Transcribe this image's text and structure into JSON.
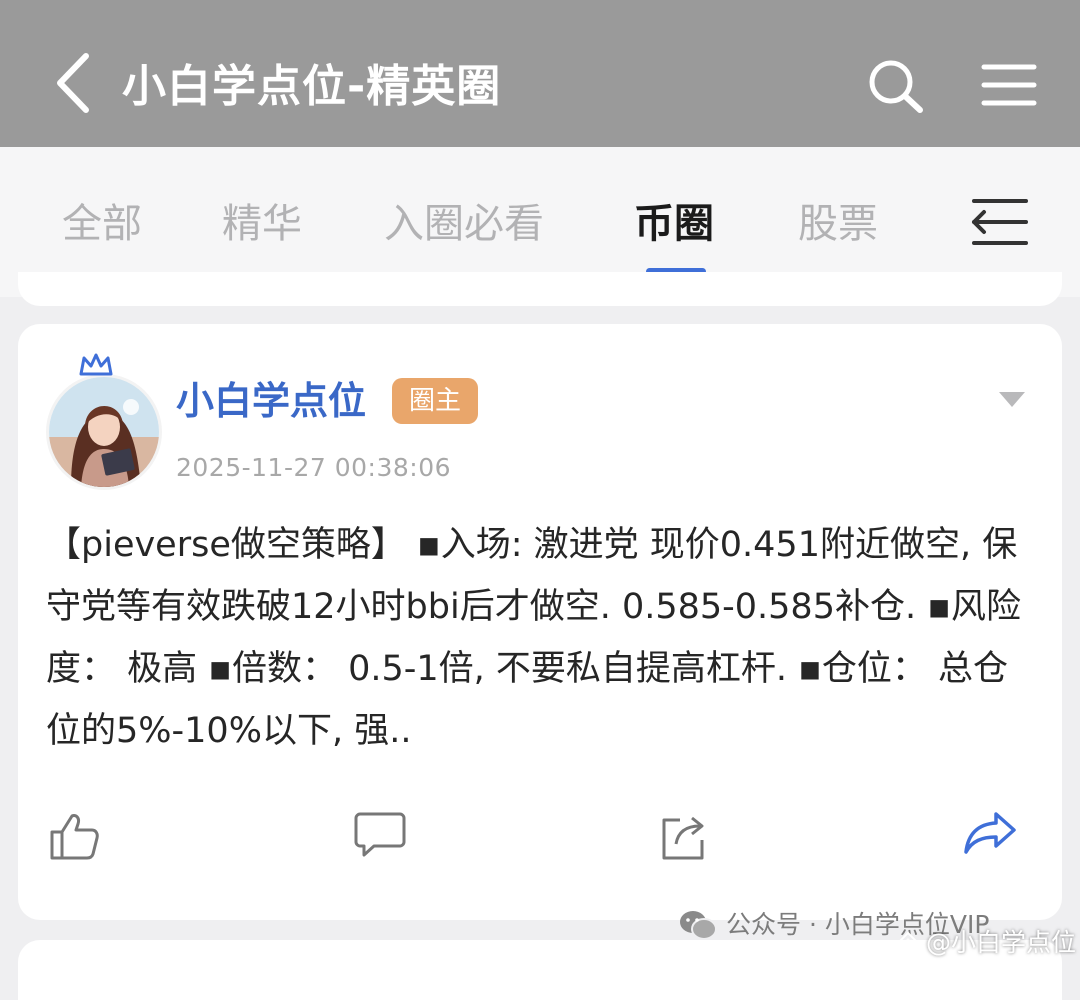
{
  "header": {
    "title": "小白学点位-精英圈",
    "icons": [
      "chevron-left-icon",
      "search-icon",
      "menu-icon"
    ]
  },
  "tabs": [
    {
      "label": "全部",
      "active": false
    },
    {
      "label": "精华",
      "active": false
    },
    {
      "label": "入圈必看",
      "active": false
    },
    {
      "label": "币圈",
      "active": true
    },
    {
      "label": "股票",
      "active": false
    }
  ],
  "post": {
    "author": "小白学点位",
    "badge": "圈主",
    "timestamp": "2025-11-27 00:38:06",
    "content": "【pieverse做空策略】 ▪入场: 激进党 现价0.451附近做空, 保守党等有效跌破12小时bbi后才做空. 0.585-0.585补仓. ▪风险度： 极高 ▪倍数： 0.5-1倍, 不要私自提高杠杆. ▪仓位： 总仓位的5%-10%以下, 强.."
  },
  "watermark": {
    "wechat": "公众号 · 小白学点位VIP",
    "handle": "@小白学点位"
  },
  "colors": {
    "header_bg": "#9a9a9a",
    "accent": "#3f6fd8",
    "author": "#3a68c7",
    "badge_bg": "#e9a66b"
  }
}
